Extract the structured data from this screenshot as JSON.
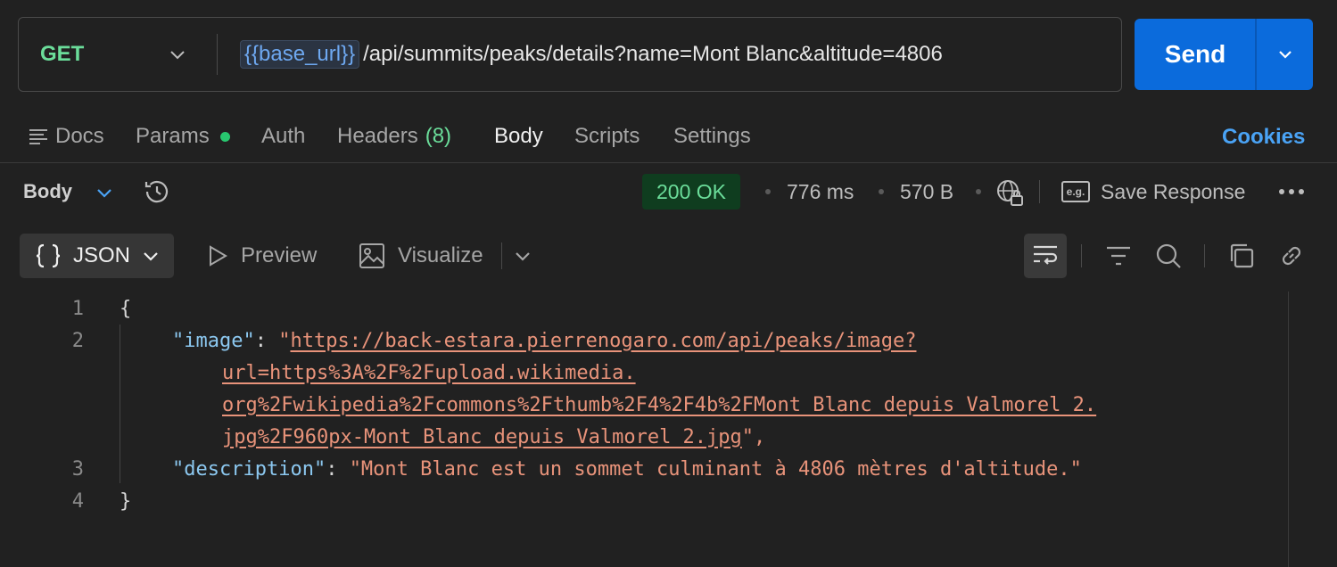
{
  "request": {
    "method": "GET",
    "url_variable": "{{base_url}}",
    "url_path": "/api/summits/peaks/details?name=Mont Blanc&altitude=4806",
    "send_label": "Send"
  },
  "tabs": {
    "docs": "Docs",
    "params": "Params",
    "auth": "Auth",
    "headers": "Headers",
    "headers_count": "(8)",
    "body": "Body",
    "scripts": "Scripts",
    "settings": "Settings",
    "cookies": "Cookies"
  },
  "response": {
    "section_label": "Body",
    "status": "200 OK",
    "time": "776 ms",
    "size": "570 B",
    "save_label": "Save Response",
    "eg_label": "e.g."
  },
  "view": {
    "format": "JSON",
    "preview": "Preview",
    "visualize": "Visualize"
  },
  "code": {
    "line_numbers": [
      "1",
      "2",
      "3",
      "4"
    ],
    "open_brace": "{",
    "close_brace": "}",
    "image_key": "\"image\"",
    "colon": ": ",
    "quote_open": "\"",
    "image_url_lines": [
      "https://back-estara.pierrenogaro.com/api/peaks/image?",
      "url=https%3A%2F%2Fupload.wikimedia.",
      "org%2Fwikipedia%2Fcommons%2Fthumb%2F4%2F4b%2FMont_Blanc_depuis_Valmorel_2.",
      "jpg%2F960px-Mont_Blanc_depuis_Valmorel_2.jpg"
    ],
    "image_tail": "\",",
    "description_key": "\"description\"",
    "description_value": "\"Mont Blanc est un sommet culminant à 4806 mètres d'altitude.\""
  },
  "colors": {
    "method": "#6bdd9a",
    "send": "#0b6bdc",
    "status_bg": "#0f3d1f",
    "status_text": "#6bdd9a",
    "link": "#4aa3f5",
    "json_key": "#8cc8f0",
    "json_string": "#e8937a"
  }
}
